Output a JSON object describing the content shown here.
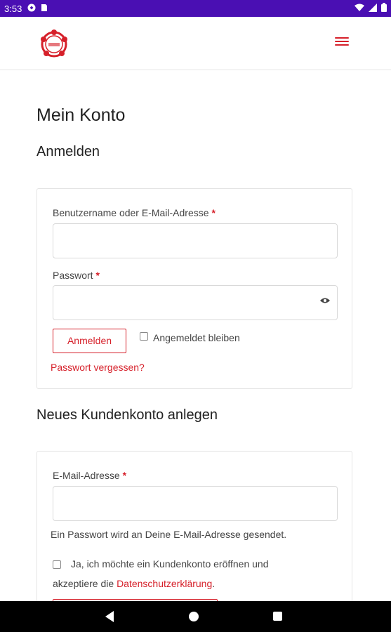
{
  "status_bar": {
    "time": "3:53",
    "icons_left": [
      "gesture-icon",
      "sim-icon"
    ],
    "icons_right": [
      "wifi-icon",
      "signal-icon",
      "battery-icon"
    ]
  },
  "header": {
    "logo_icon": "site-logo",
    "menu_icon": "hamburger-menu-icon",
    "accent": "#d6202a"
  },
  "page": {
    "title": "Mein Konto"
  },
  "login": {
    "heading": "Anmelden",
    "username_label": "Benutzername oder E-Mail-Adresse",
    "username_value": "",
    "password_label": "Passwort",
    "password_value": "",
    "required_mark": "*",
    "submit_label": "Anmelden",
    "remember_label": "Angemeldet bleiben",
    "remember_checked": false,
    "forgot_label": "Passwort vergessen?"
  },
  "register": {
    "heading": "Neues Kundenkonto anlegen",
    "email_label": "E-Mail-Adresse",
    "email_value": "",
    "required_mark": "*",
    "password_note": "Ein Passwort wird an Deine E-Mail-Adresse gesendet.",
    "consent_text_1": "Ja, ich möchte ein Kundenkonto eröffnen und",
    "consent_text_2": "akzeptiere die",
    "privacy_link": "Datenschutzerklärung",
    "consent_end": ".",
    "consent_checked": false
  },
  "nav_bar": {
    "back_icon": "back-icon",
    "home_icon": "home-icon",
    "recents_icon": "recents-icon"
  }
}
